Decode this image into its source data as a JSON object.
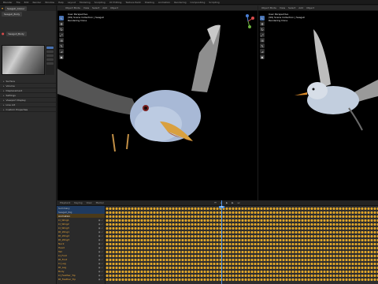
{
  "topbar": {
    "items": [
      "Blender",
      "File",
      "Edit",
      "Render",
      "Window",
      "Help",
      "Layout",
      "Modeling",
      "Sculpting",
      "UV Editing",
      "Texture Paint",
      "Shading",
      "Animation",
      "Rendering",
      "Compositing",
      "Scripting"
    ]
  },
  "properties": {
    "object_name": "Seagull_Colour",
    "datablock": "Seagull_Body",
    "material": "Seagull_Body",
    "tabs": [
      "Surface",
      "Volume",
      "Displacement",
      "Settings",
      "Viewport Display",
      "Line Art",
      "Custom Properties"
    ],
    "active_tab": 1
  },
  "viewport_left": {
    "header": [
      "Object Mode",
      "View",
      "Select",
      "Add",
      "Object"
    ],
    "info": [
      "User Perspective",
      "(99) Scene Collection | Seagull",
      "Rendering Done"
    ],
    "tools": [
      "cursor",
      "move",
      "rotate",
      "scale",
      "transform",
      "annotate",
      "measure",
      "add-cube"
    ]
  },
  "viewport_right": {
    "header": [
      "Object Mode",
      "View",
      "Select",
      "Add",
      "Object"
    ],
    "info": [
      "User Perspective",
      "(99) Scene Collection | Seagull",
      "Rendering Done"
    ]
  },
  "timeline": {
    "header": [
      "Playback",
      "Keying",
      "View",
      "Marker"
    ],
    "current_frame": "99",
    "channels": [
      {
        "label": "Summary",
        "kind": "arm"
      },
      {
        "label": "Seagull_Rig",
        "kind": "arm"
      },
      {
        "label": "Animation",
        "kind": "act"
      },
      {
        "label": "Lt_Wing1",
        "kind": "bone"
      },
      {
        "label": "Lt_Wing2",
        "kind": "bone"
      },
      {
        "label": "Lt_Wing3",
        "kind": "bone"
      },
      {
        "label": "Rt_Wing1",
        "kind": "bone"
      },
      {
        "label": "Rt_Wing2",
        "kind": "bone"
      },
      {
        "label": "Rt_Wing3",
        "kind": "bone"
      },
      {
        "label": "Neck",
        "kind": "bone"
      },
      {
        "label": "Head",
        "kind": "bone"
      },
      {
        "label": "Tail",
        "kind": "bone"
      },
      {
        "label": "Lt_Foot",
        "kind": "bone"
      },
      {
        "label": "Rt_Foot",
        "kind": "bone"
      },
      {
        "label": "Lt_Leg",
        "kind": "bone"
      },
      {
        "label": "Rt_Leg",
        "kind": "bone"
      },
      {
        "label": "Body",
        "kind": "bone"
      },
      {
        "label": "Lt_Feather_Tip",
        "kind": "bone"
      },
      {
        "label": "Rt_Feather_Tip",
        "kind": "bone"
      }
    ]
  }
}
